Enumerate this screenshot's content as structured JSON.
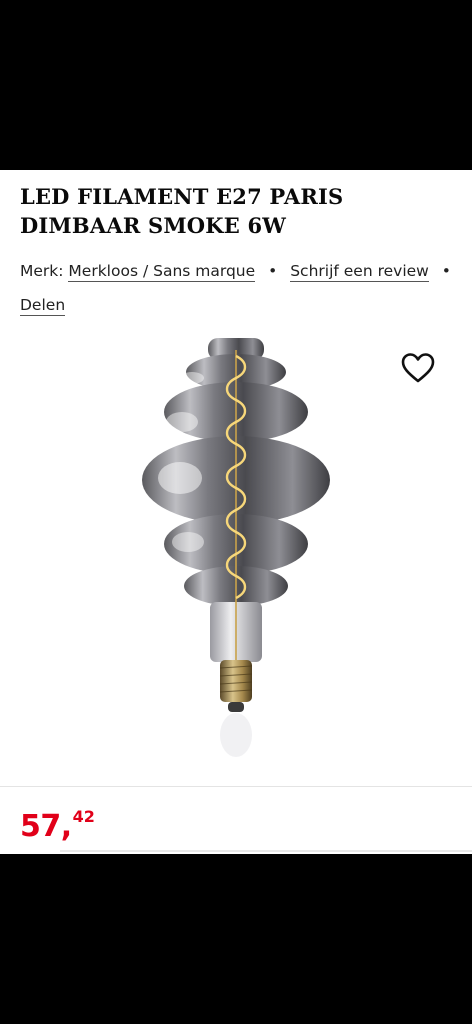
{
  "product": {
    "title": "LED FILAMENT E27 PARIS DIMBAAR SMOKE 6W",
    "brand_label": "Merk:",
    "brand_name": "Merkloos / Sans marque",
    "review_link": "Schrijf een review",
    "share_link": "Delen",
    "separator": "•",
    "image_icon": "filament-bulb-image",
    "wishlist_icon": "heart-icon"
  },
  "price": {
    "whole": "57",
    "separator": ",",
    "cents": "42"
  },
  "colors": {
    "price": "#e10019",
    "title": "#0a0a0a"
  }
}
